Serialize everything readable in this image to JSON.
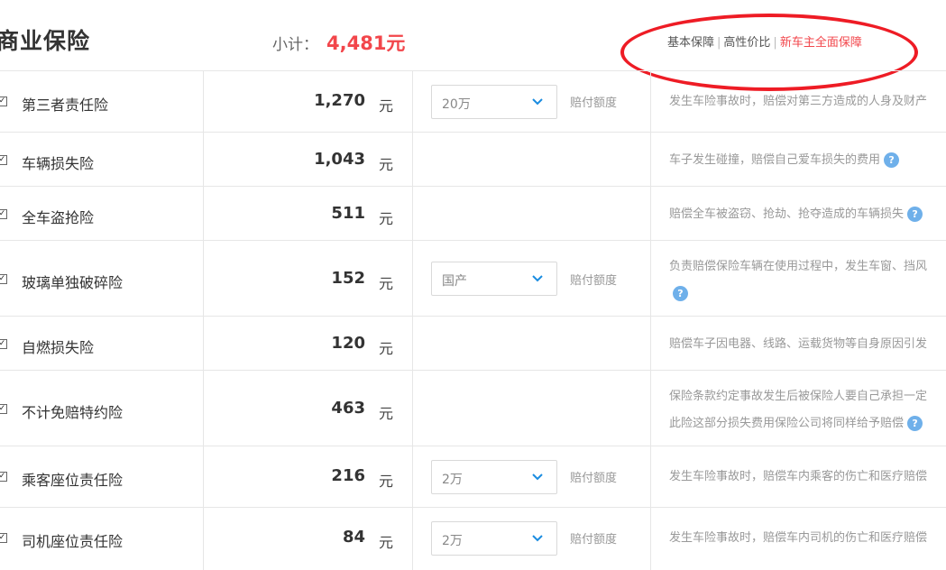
{
  "header": {
    "title": "商业保险",
    "subtotal_label": "小计：",
    "subtotal_value": "4,481元",
    "plans": [
      "基本保障",
      "高性价比",
      "新车主全面保障"
    ],
    "plan_active_color": "#f2464b"
  },
  "rows": [
    {
      "name": "第三者责任险",
      "price": "1,270",
      "unit": "元",
      "select": "20万",
      "select_label": "赔付额度",
      "desc": [
        "发生车险事故时，赔偿对第三方造成的人身及财产"
      ]
    },
    {
      "name": "车辆损失险",
      "price": "1,043",
      "unit": "元",
      "desc": [
        "车子发生碰撞，赔偿自己爱车损失的费用"
      ],
      "help": "?"
    },
    {
      "name": "全车盗抢险",
      "price": "511",
      "unit": "元",
      "desc": [
        "赔偿全车被盗窃、抢劫、抢夺造成的车辆损失"
      ],
      "help": "?"
    },
    {
      "name": "玻璃单独破碎险",
      "price": "152",
      "unit": "元",
      "select": "国产",
      "select_label": "赔付额度",
      "desc": [
        "负责赔偿保险车辆在使用过程中，发生车窗、挡风"
      ],
      "help": "?"
    },
    {
      "name": "自燃损失险",
      "price": "120",
      "unit": "元",
      "desc": [
        "赔偿车子因电器、线路、运载货物等自身原因引发"
      ]
    },
    {
      "name": "不计免赔特约险",
      "price": "463",
      "unit": "元",
      "desc": [
        "保险条款约定事故发生后被保险人要自己承担一定",
        "此险这部分损失费用保险公司将同样给予赔偿"
      ],
      "help": "?"
    },
    {
      "name": "乘客座位责任险",
      "price": "216",
      "unit": "元",
      "select": "2万",
      "select_label": "赔付额度",
      "desc": [
        "发生车险事故时，赔偿车内乘客的伤亡和医疗赔偿"
      ]
    },
    {
      "name": "司机座位责任险",
      "price": "84",
      "unit": "元",
      "select": "2万",
      "select_label": "赔付额度",
      "desc": [
        "发生车险事故时，赔偿车内司机的伤亡和医疗赔偿"
      ]
    }
  ]
}
